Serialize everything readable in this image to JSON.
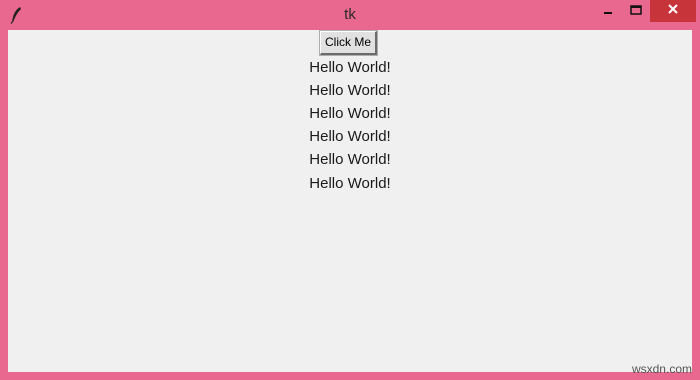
{
  "window": {
    "title": "tk",
    "icons": {
      "app": "feather-icon",
      "minimize": "minimize-icon",
      "maximize": "maximize-icon",
      "close": "close-icon"
    },
    "colors": {
      "frame": "#e8688f",
      "close_button": "#c7343a",
      "client_background": "#f0f0f0"
    }
  },
  "content": {
    "button_label": "Click Me",
    "labels": [
      "Hello World!",
      "Hello World!",
      "Hello World!",
      "Hello World!",
      "Hello World!",
      "Hello World!"
    ]
  },
  "watermark": "wsxdn.com"
}
